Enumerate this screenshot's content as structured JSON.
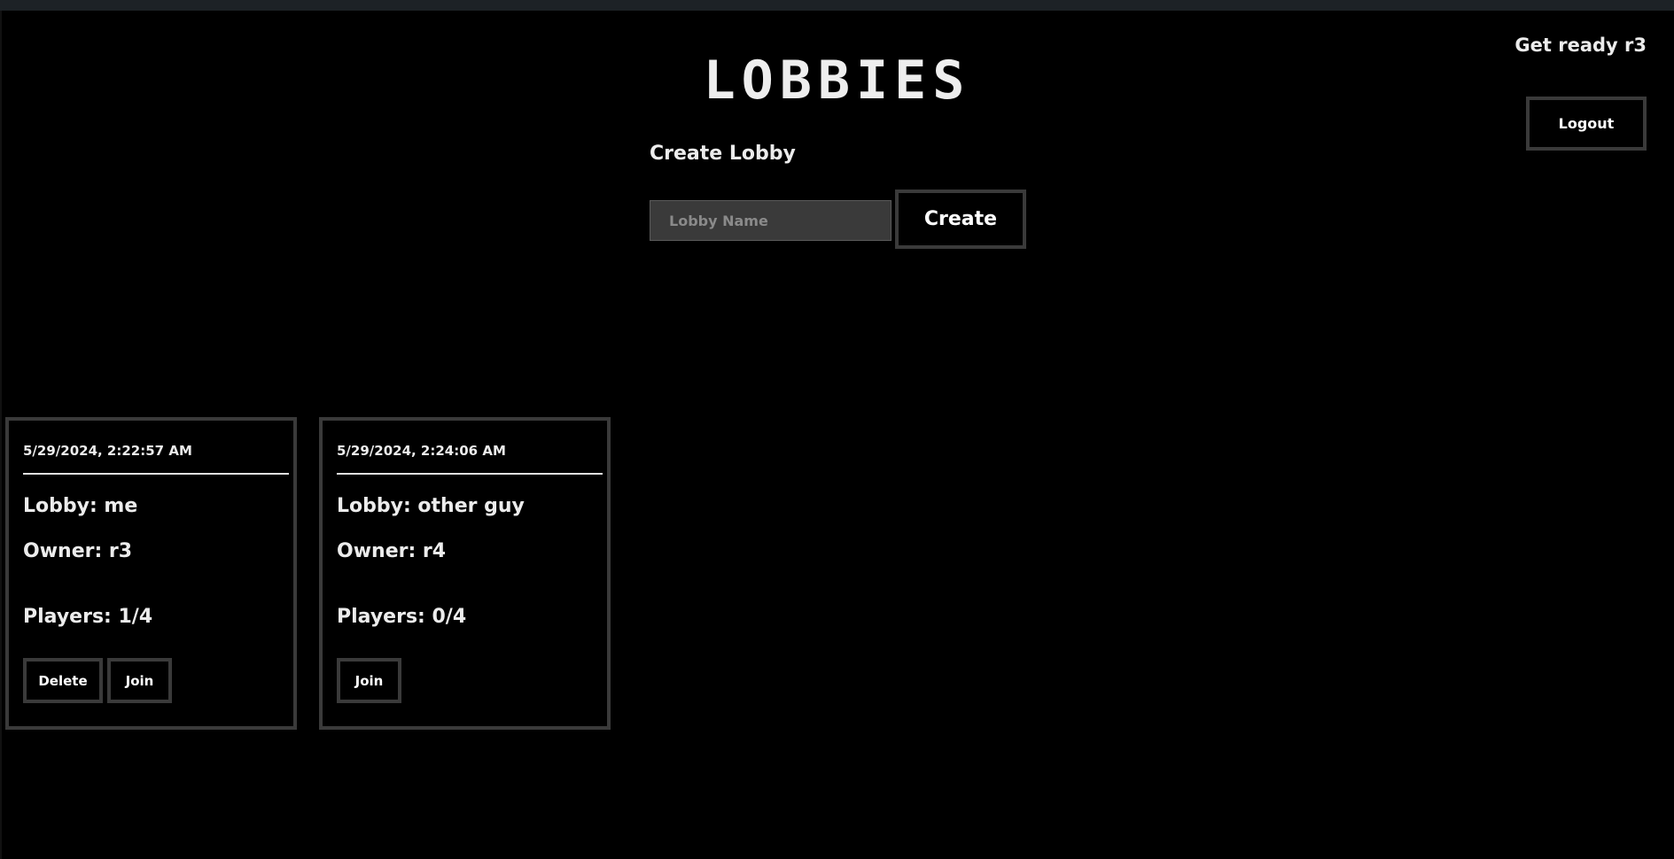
{
  "header": {
    "greeting": "Get ready r3",
    "logout_label": "Logout",
    "title": "LOBBIES"
  },
  "create": {
    "heading": "Create Lobby",
    "input_placeholder": "Lobby Name",
    "input_value": "",
    "button_label": "Create"
  },
  "lobbies": [
    {
      "timestamp": "5/29/2024, 2:22:57 AM",
      "name": "Lobby: me",
      "owner": "Owner: r3",
      "players": "Players: 1/4",
      "delete_label": "Delete",
      "join_label": "Join"
    },
    {
      "timestamp": "5/29/2024, 2:24:06 AM",
      "name": "Lobby: other guy",
      "owner": "Owner: r4",
      "players": "Players: 0/4",
      "join_label": "Join"
    }
  ],
  "colors": {
    "background": "#000000",
    "border": "#3a3a3a",
    "text": "#ececec",
    "input_background": "#3a3a3a"
  }
}
